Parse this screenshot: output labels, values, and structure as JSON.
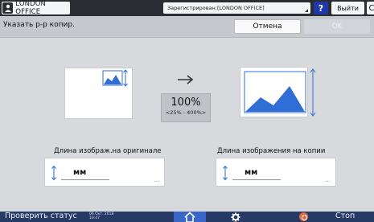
{
  "header": {
    "office_name": "LONDON OFFICE",
    "login_status": "Зарегистрирован:[LONDON OFFICE]",
    "help_label": "?",
    "logout_label": "Выйти",
    "back_label": "C"
  },
  "title_bar": {
    "title": "Указать р-р копир.",
    "cancel_label": "Отмена",
    "ok_label": "OK"
  },
  "ratio": {
    "value": "100%",
    "range": "<25% - 400%>"
  },
  "original_length": {
    "label": "Длина изображ.на оригинале",
    "unit": "мм",
    "more": "..."
  },
  "copy_length": {
    "label": "Длина изображения на копии",
    "unit": "мм",
    "more": "..."
  },
  "footer": {
    "status_check_label": "Проверить статус",
    "date": "06 Окт. 2018",
    "time": "10:47",
    "stop_label": "Стоп"
  },
  "colors": {
    "accent": "#1f3aa8",
    "image_blue": "#2e6ed6",
    "footer_bg": "#263a66",
    "stop": "#e3683e"
  }
}
